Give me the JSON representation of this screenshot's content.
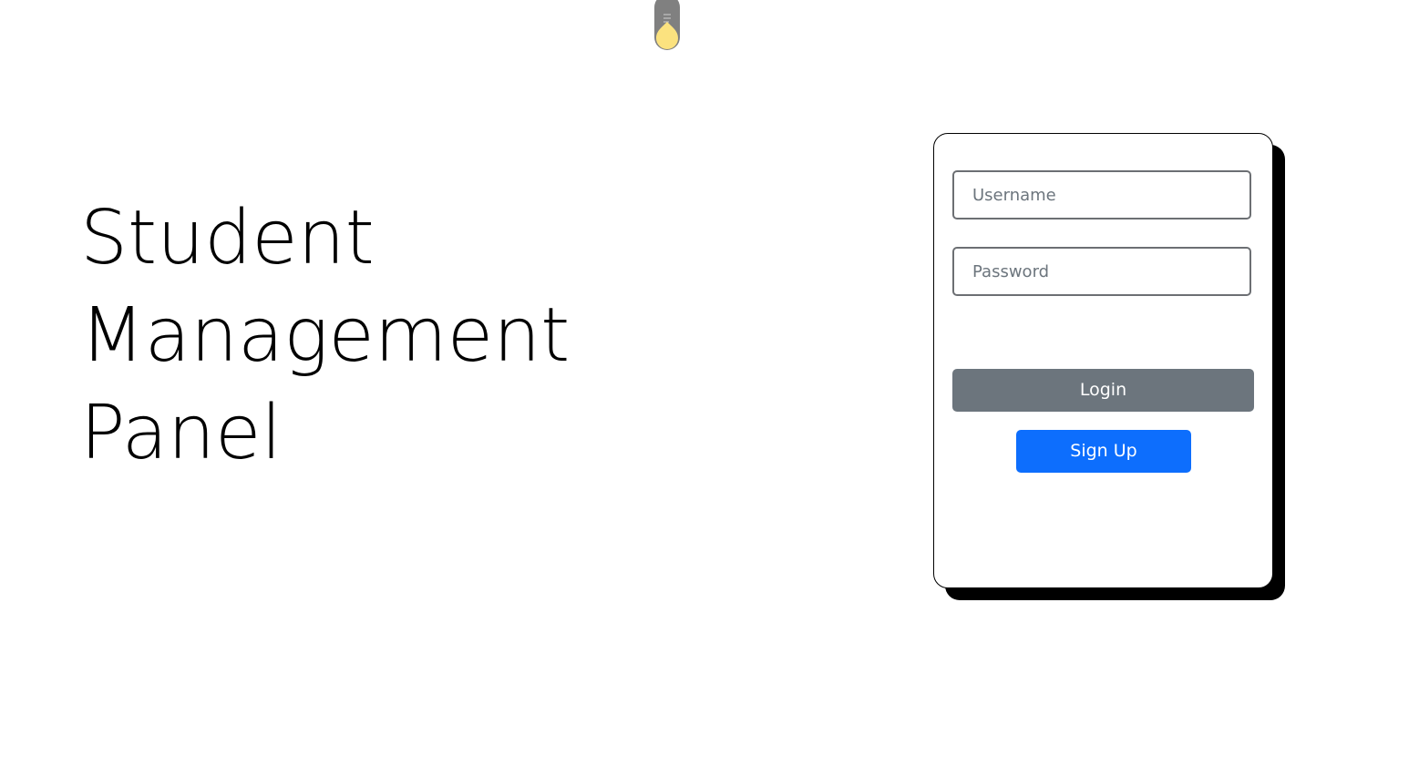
{
  "hero": {
    "title_line_1": "Student",
    "title_line_2": "Management",
    "title_line_3": "Panel"
  },
  "theme_toggle": {
    "icon": "lightbulb-icon",
    "bulb_color": "#fbe27f",
    "base_color": "#808080"
  },
  "login_form": {
    "username_placeholder": "Username",
    "username_value": "",
    "password_placeholder": "Password",
    "password_value": "",
    "login_label": "Login",
    "signup_label": "Sign Up"
  },
  "colors": {
    "login_button": "#6c757d",
    "signup_button": "#0d6efd",
    "card_border": "#000000",
    "card_shadow": "#000000"
  }
}
